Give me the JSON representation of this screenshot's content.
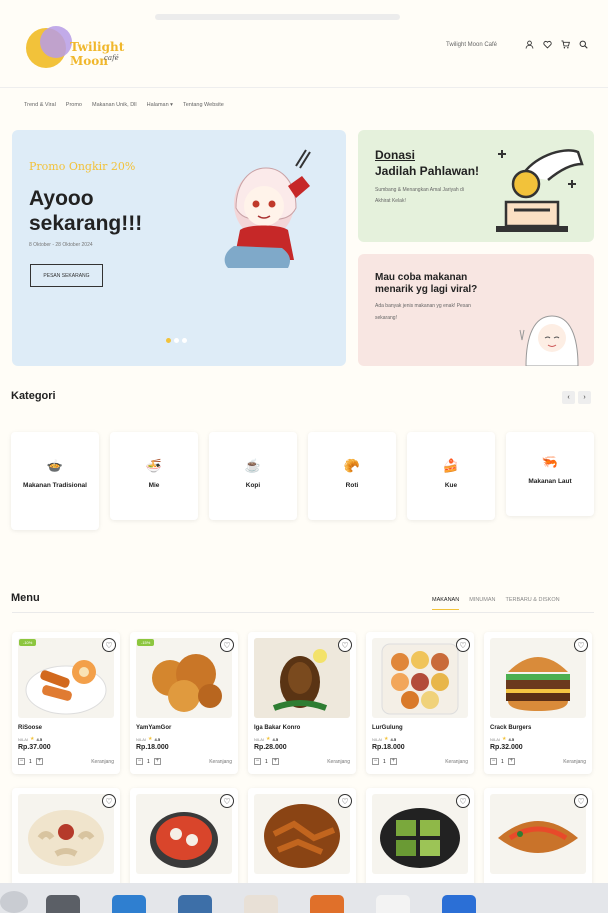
{
  "header": {
    "logo_text": "Twilight Moon",
    "logo_sub": "café",
    "cafe_name": "Twilight Moon Café",
    "icons": [
      "user-icon",
      "heart-icon",
      "cart-icon",
      "search-icon"
    ]
  },
  "nav": {
    "items": [
      "Trend & Viral",
      "Promo",
      "Makanan Unik, Dll",
      "Halaman",
      "Tentang Website"
    ]
  },
  "banner_main": {
    "promo": "Promo Ongkir 20%",
    "headline": "Ayooo sekarang!!!",
    "dates": "8 Oktober - 28 Oktober 2024",
    "button": "PESAN SEKARANG"
  },
  "banner_donasi": {
    "title": "Donasi",
    "subtitle": "Jadilah Pahlawan!",
    "desc": "Sumbang & Menangkan Amal Jariyah di Akhirat Kelak!"
  },
  "banner_viral": {
    "title": "Mau coba makanan menarik yg lagi viral?",
    "desc": "Ada banyak jenis makanan yg enak! Pesan sekarang!"
  },
  "kategori": {
    "title": "Kategori",
    "items": [
      {
        "label": "Makanan Tradisional",
        "icon": "🍲"
      },
      {
        "label": "Mie",
        "icon": "🍜"
      },
      {
        "label": "Kopi",
        "icon": "☕"
      },
      {
        "label": "Roti",
        "icon": "🥐"
      },
      {
        "label": "Kue",
        "icon": "🍰"
      },
      {
        "label": "Makanan Laut",
        "icon": "🦐"
      }
    ]
  },
  "menu": {
    "title": "Menu",
    "tabs": [
      "MAKANAN",
      "MINUMAN",
      "TERBARU & DISKON"
    ],
    "rating_label": "NILAI",
    "cart_label": "Keranjang",
    "qty": "1",
    "items": [
      {
        "name": "RiSoose",
        "rating": "4.5",
        "price": "Rp.37.000",
        "badge": "-10%"
      },
      {
        "name": "YamYamGor",
        "rating": "4.5",
        "price": "Rp.18.000",
        "badge": "-15%"
      },
      {
        "name": "Iga Bakar Konro",
        "rating": "4.5",
        "price": "Rp.28.000",
        "badge": ""
      },
      {
        "name": "LurGulung",
        "rating": "4.5",
        "price": "Rp.18.000",
        "badge": ""
      },
      {
        "name": "Crack Burgers",
        "rating": "4.5",
        "price": "Rp.32.000",
        "badge": ""
      }
    ]
  },
  "colors": {
    "accent": "#f2c23a",
    "banner_blue": "#deecf7",
    "banner_green": "#e5f1dc",
    "banner_pink": "#f8e6e2",
    "badge_green": "#8cc63f"
  }
}
